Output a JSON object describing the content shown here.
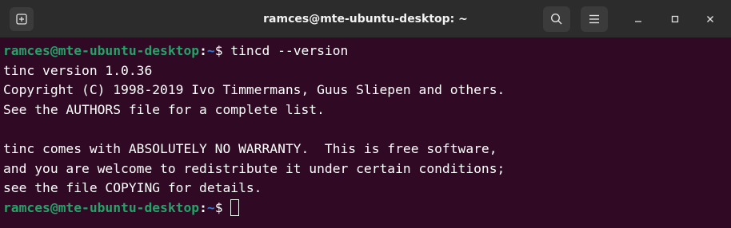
{
  "window": {
    "title": "ramces@mte-ubuntu-desktop: ~"
  },
  "titlebar": {
    "buttons": [
      "new-tab-icon",
      "search-icon",
      "menu-icon",
      "minimize-icon",
      "maximize-icon",
      "close-icon"
    ]
  },
  "terminal": {
    "prompt_user_host": "ramces@mte-ubuntu-desktop",
    "prompt_colon": ":",
    "prompt_path": "~",
    "prompt_symbol": "$ ",
    "command": "tincd --version",
    "output": [
      "tinc version 1.0.36",
      "Copyright (C) 1998-2019 Ivo Timmermans, Guus Sliepen and others.",
      "See the AUTHORS file for a complete list.",
      "",
      "tinc comes with ABSOLUTELY NO WARRANTY.  This is free software,",
      "and you are welcome to redistribute it under certain conditions;",
      "see the file COPYING for details."
    ]
  },
  "colors": {
    "background": "#300a24",
    "titlebar": "#2c2c2c",
    "prompt_user": "#26a269",
    "prompt_path": "#2a7bde",
    "text": "#ffffff"
  }
}
